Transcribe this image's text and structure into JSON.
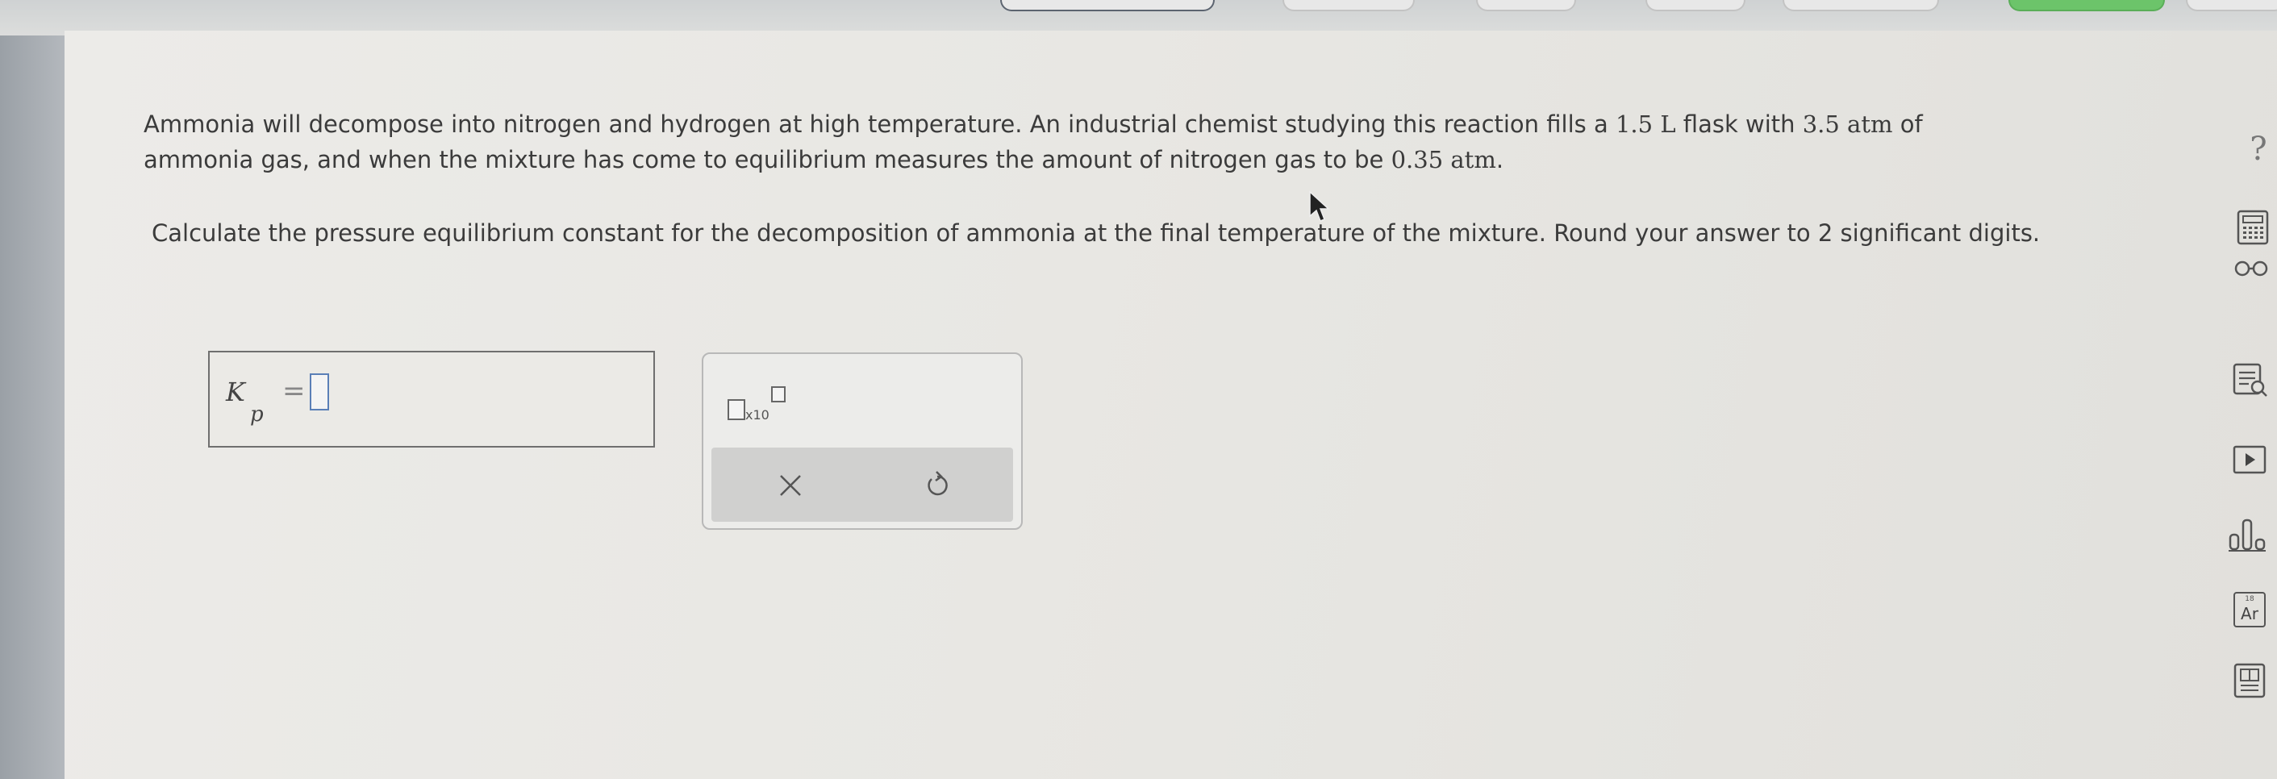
{
  "question": {
    "line1_a": "Ammonia will decompose into nitrogen and hydrogen at high temperature. An industrial chemist studying this reaction fills a ",
    "volume": "1.5 L",
    "line1_b": " flask with ",
    "initial_pressure": "3.5 atm",
    "line1_c": " of",
    "line2_a": "ammonia gas, and when the mixture has come to equilibrium measures the amount of nitrogen gas to be ",
    "nitrogen_pressure": "0.35 atm",
    "line2_b": ".",
    "ask_a": "Calculate the pressure equilibrium constant for the decomposition of ammonia at the final temperature of the mixture. Round your answer to ",
    "sig_digits": "2",
    "ask_b": " significant digits."
  },
  "answer": {
    "symbol": "K",
    "subscript": "p",
    "equals": "=",
    "value": ""
  },
  "tools": {
    "x10_label": "x10",
    "clear_icon": "close-icon",
    "undo_icon": "undo-icon"
  },
  "toolbar": {
    "help": "?",
    "calculator_icon": "calculator-icon",
    "glasses_icon": "glasses-icon",
    "textbook_icon": "textbook-icon",
    "video_icon": "video-icon",
    "data_icon": "bar-chart-icon",
    "periodic_label": "Ar",
    "periodic_number": "18",
    "periodic_icon": "periodic-table-icon",
    "notes_icon": "reference-icon"
  },
  "colors": {
    "accent_slot": "#5a7fb7",
    "active_tab": "#6cc46a"
  }
}
